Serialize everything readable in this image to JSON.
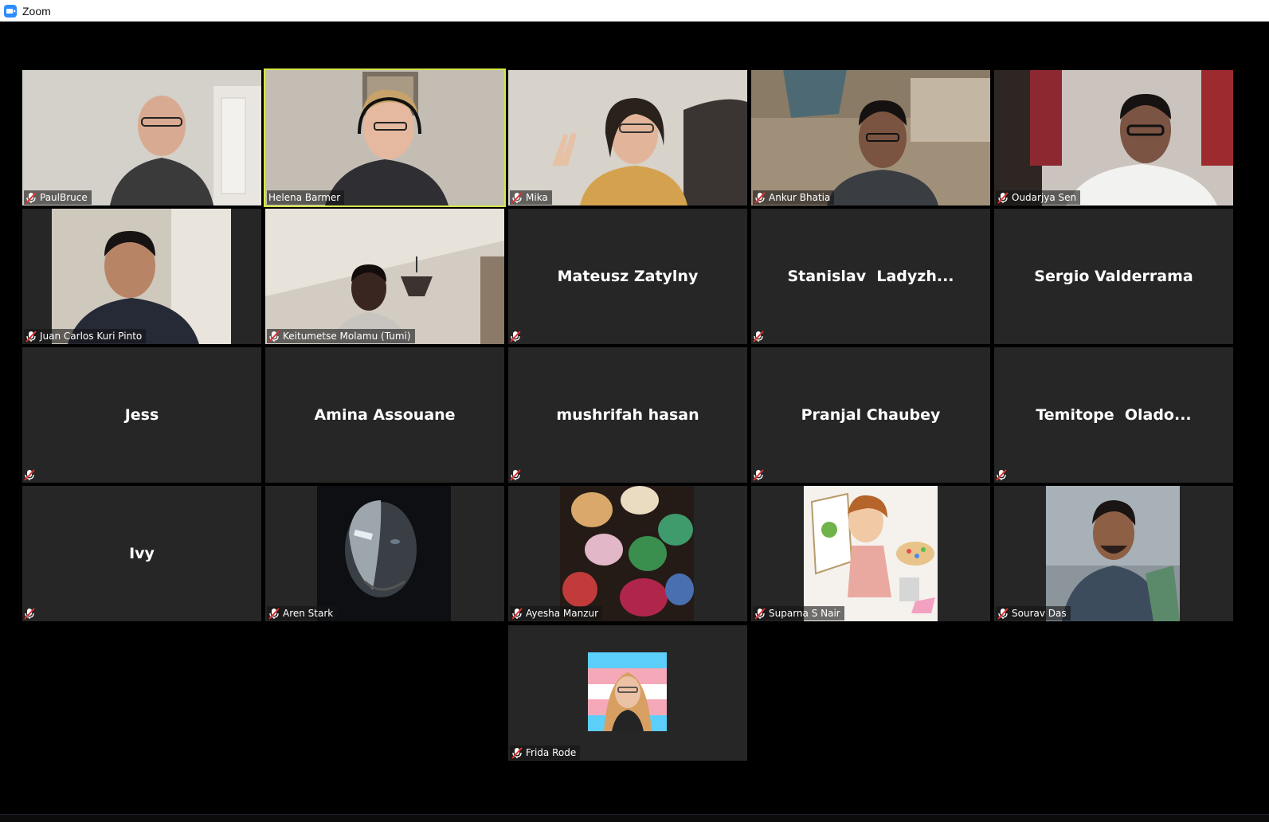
{
  "window": {
    "title": "Zoom",
    "icon": "zoom-camera-icon",
    "accent": "#2d8cff"
  },
  "active_speaker_color": "#d6e64a",
  "participants": [
    {
      "name": "PaulBruce",
      "muted": true,
      "video": "camera",
      "bg": "#cfcac3"
    },
    {
      "name": "Helena Barmer",
      "muted": false,
      "video": "camera",
      "active": true,
      "bg": "#bdb4a8"
    },
    {
      "name": "Mika",
      "muted": true,
      "video": "camera",
      "bg": "#d9d4cc"
    },
    {
      "name": "Ankur Bhatia",
      "muted": true,
      "video": "camera",
      "bg": "#9b8d7a"
    },
    {
      "name": "Oudarjya Sen",
      "muted": true,
      "video": "camera",
      "bg": "#c9c2bc"
    },
    {
      "name": "Juan Carlos Kuri Pinto",
      "muted": true,
      "video": "camera",
      "bg": "#c7bfb3"
    },
    {
      "name": "Keitumetse Molamu (Tumi)",
      "muted": true,
      "video": "camera",
      "bg": "#cbc5bb"
    },
    {
      "name": "Mateusz Zatylny",
      "muted": true,
      "video": "off"
    },
    {
      "name": "Stanislav  Ladyzh...",
      "muted": true,
      "video": "off"
    },
    {
      "name": "Sergio Valderrama",
      "muted": false,
      "video": "off"
    },
    {
      "name": "Jess",
      "muted": true,
      "video": "off"
    },
    {
      "name": "Amina Assouane",
      "muted": false,
      "video": "off"
    },
    {
      "name": "mushrifah hasan",
      "muted": true,
      "video": "off"
    },
    {
      "name": "Pranjal Chaubey",
      "muted": true,
      "video": "off"
    },
    {
      "name": "Temitope  Olado...",
      "muted": true,
      "video": "off"
    },
    {
      "name": "Ivy",
      "muted": true,
      "video": "off"
    },
    {
      "name": "Aren Stark",
      "muted": true,
      "video": "picture",
      "bg": "#1a1c20"
    },
    {
      "name": "Ayesha Manzur",
      "muted": true,
      "video": "picture",
      "bg": "#3a2a22"
    },
    {
      "name": "Suparna S Nair",
      "muted": true,
      "video": "picture",
      "bg": "#f4f1ec"
    },
    {
      "name": "Sourav Das",
      "muted": true,
      "video": "picture",
      "bg": "#9aa6ad"
    },
    {
      "name": "Frida Rode",
      "muted": true,
      "video": "picture",
      "bg": "#9fd0ea"
    }
  ]
}
